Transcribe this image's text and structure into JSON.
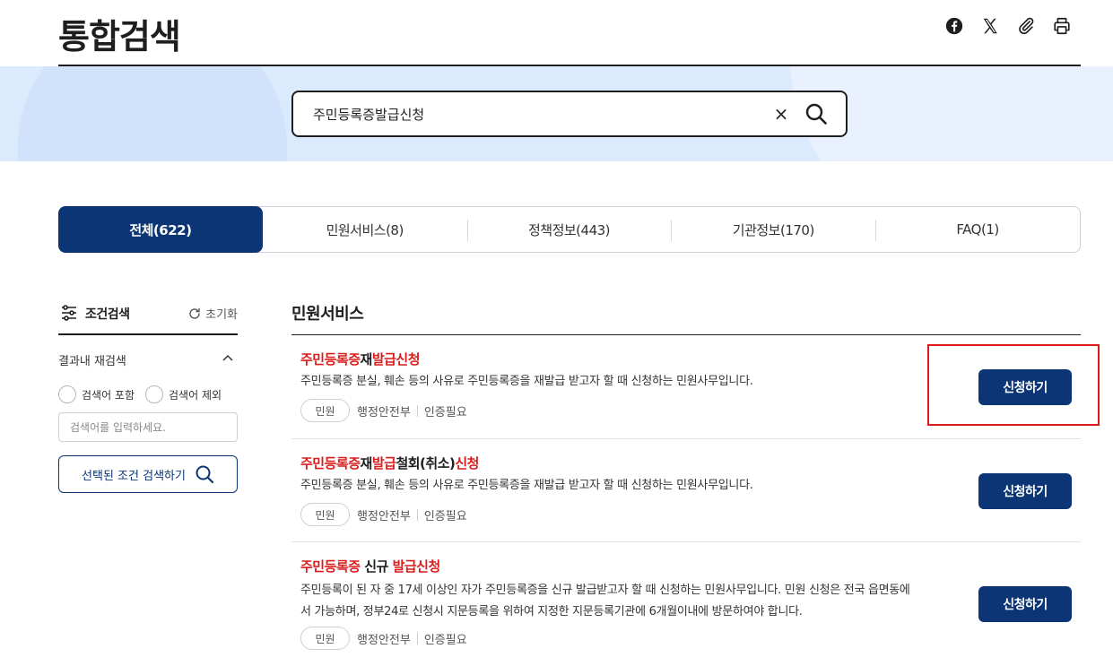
{
  "page": {
    "title": "통합검색"
  },
  "share": [
    {
      "name": "facebook-icon"
    },
    {
      "name": "x-icon"
    },
    {
      "name": "link-icon"
    },
    {
      "name": "print-icon"
    }
  ],
  "search": {
    "value": "주민등록증발급신청",
    "clear_label": "×"
  },
  "tabs": [
    {
      "label": "전체(622)",
      "active": true
    },
    {
      "label": "민원서비스(8)"
    },
    {
      "label": "정책정보(443)"
    },
    {
      "label": "기관정보(170)"
    },
    {
      "label": "FAQ(1)"
    }
  ],
  "filter": {
    "title": "조건검색",
    "reset_label": "초기화",
    "research_label": "결과내 재검색",
    "include_label": "검색어 포함",
    "exclude_label": "검색어 제외",
    "keyword_placeholder": "검색어를 입력하세요.",
    "search_button": "선택된 조건 검색하기"
  },
  "results": {
    "section_title": "민원서비스",
    "items": [
      {
        "title_parts": [
          {
            "text": "주민등록증",
            "hl": true
          },
          {
            "text": "재",
            "hl": false
          },
          {
            "text": "발급신청",
            "hl": true
          }
        ],
        "desc": "주민등록증 분실, 훼손 등의 사유로 주민등록증을 재발급 받고자 할 때 신청하는 민원사무입니다.",
        "tag": "민원",
        "agency": "행정안전부",
        "auth": "인증필요",
        "button": "신청하기"
      },
      {
        "title_parts": [
          {
            "text": "주민등록증",
            "hl": true
          },
          {
            "text": "재",
            "hl": false
          },
          {
            "text": "발급",
            "hl": true
          },
          {
            "text": "철회(취소)",
            "hl": false
          },
          {
            "text": "신청",
            "hl": true
          }
        ],
        "desc": "주민등록증 분실, 훼손 등의 사유로 주민등록증을 재발급 받고자 할 때 신청하는 민원사무입니다.",
        "tag": "민원",
        "agency": "행정안전부",
        "auth": "인증필요",
        "button": "신청하기"
      },
      {
        "title_parts": [
          {
            "text": "주민등록증",
            "hl": true
          },
          {
            "text": " 신규 ",
            "hl": false
          },
          {
            "text": "발급신청",
            "hl": true
          }
        ],
        "desc_lines": [
          "주민등록이 된 자 중 17세 이상인 자가 주민등록증을 신규 발급받고자 할 때 신청하는 민원사무입니다. 민원 신청은 전국 읍면동에",
          "서 가능하며, 정부24로 신청시 지문등록을 위하여 지정한 지문등록기관에 6개월이내에 방문하여야 합니다."
        ],
        "tag": "민원",
        "agency": "행정안전부",
        "auth": "인증필요",
        "button": "신청하기"
      }
    ]
  },
  "colors": {
    "primary": "#0b3575",
    "highlight": "#d91c1c",
    "band": "#dceafd",
    "annotation_box": "#e31919"
  }
}
